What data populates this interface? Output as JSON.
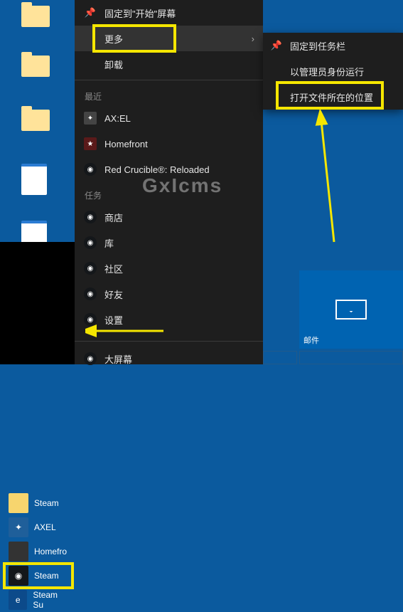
{
  "context": {
    "pin_start": "固定到\"开始\"屏幕",
    "more": "更多",
    "uninstall": "卸载",
    "recent_header": "最近",
    "recent": [
      {
        "label": "AX:EL"
      },
      {
        "label": "Homefront"
      },
      {
        "label": "Red Crucible®: Reloaded"
      }
    ],
    "tasks_header": "任务",
    "tasks": [
      {
        "label": "商店"
      },
      {
        "label": "库"
      },
      {
        "label": "社区"
      },
      {
        "label": "好友"
      },
      {
        "label": "设置"
      }
    ],
    "big_picture": "大屏幕"
  },
  "submenu": {
    "pin_taskbar": "固定到任务栏",
    "run_admin": "以管理员身份运行",
    "open_location": "打开文件所在的位置"
  },
  "tiles": {
    "steam": "Steam",
    "axel": "AXEL",
    "homefront": "Homefro",
    "steam2": "Steam",
    "steam_su": "Steam Su"
  },
  "live_tile": {
    "mail": "邮件"
  },
  "watermark": "GxIcms"
}
